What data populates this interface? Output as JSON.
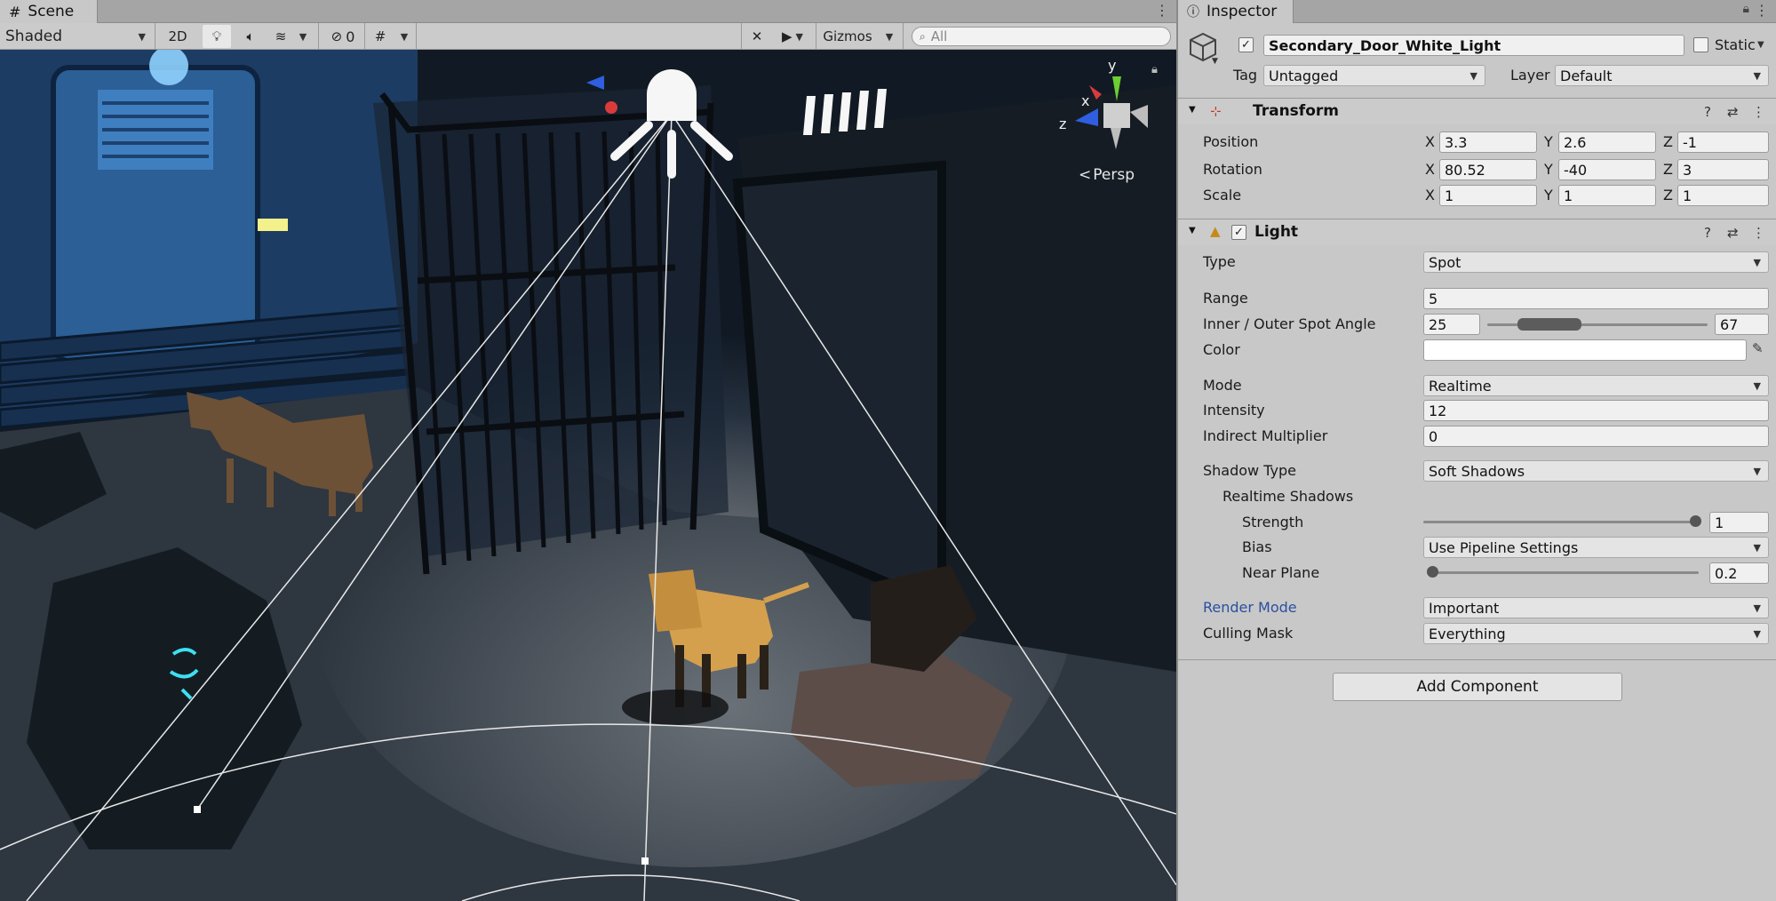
{
  "scene": {
    "tab_label": "Scene",
    "toolbar": {
      "draw_mode": "Shaded",
      "mode_2d": "2D",
      "hidden_count": "0",
      "gizmos": "Gizmos",
      "search_placeholder": "All"
    },
    "view": {
      "projection": "Persp",
      "axis_labels": {
        "x": "x",
        "y": "y",
        "z": "z"
      }
    }
  },
  "inspector": {
    "tab_label": "Inspector",
    "object": {
      "name": "Secondary_Door_White_Light",
      "active": true,
      "static_label": "Static",
      "static": false,
      "tag_label": "Tag",
      "tag": "Untagged",
      "layer_label": "Layer",
      "layer": "Default"
    },
    "transform": {
      "title": "Transform",
      "position": {
        "label": "Position",
        "x": "3.3",
        "y": "2.6",
        "z": "-1"
      },
      "rotation": {
        "label": "Rotation",
        "x": "80.52",
        "y": "-40",
        "z": "3"
      },
      "scale": {
        "label": "Scale",
        "x": "1",
        "y": "1",
        "z": "1"
      },
      "axis_x": "X",
      "axis_y": "Y",
      "axis_z": "Z"
    },
    "light": {
      "title": "Light",
      "enabled": true,
      "type_label": "Type",
      "type": "Spot",
      "range_label": "Range",
      "range": "5",
      "spot_angle_label": "Inner / Outer Spot Angle",
      "inner_angle": "25",
      "outer_angle": "67",
      "color_label": "Color",
      "color": "#ffffff",
      "mode_label": "Mode",
      "mode": "Realtime",
      "intensity_label": "Intensity",
      "intensity": "12",
      "indirect_label": "Indirect Multiplier",
      "indirect": "0",
      "shadow_type_label": "Shadow Type",
      "shadow_type": "Soft Shadows",
      "realtime_shadows_label": "Realtime Shadows",
      "strength_label": "Strength",
      "strength": "1",
      "bias_label": "Bias",
      "bias": "Use Pipeline Settings",
      "near_plane_label": "Near Plane",
      "near_plane": "0.2",
      "render_mode_label": "Render Mode",
      "render_mode": "Important",
      "culling_mask_label": "Culling Mask",
      "culling_mask": "Everything"
    },
    "add_component": "Add Component"
  },
  "colors": {
    "panel_bg": "#c8c8c8",
    "tab_bar": "#a5a5a5",
    "render_mode_label": "#2a4fa0",
    "axis_x": "#d93b3b",
    "axis_y": "#6ccf2f",
    "axis_z": "#2f5fe0",
    "dog_tan": "#d4a04e"
  }
}
